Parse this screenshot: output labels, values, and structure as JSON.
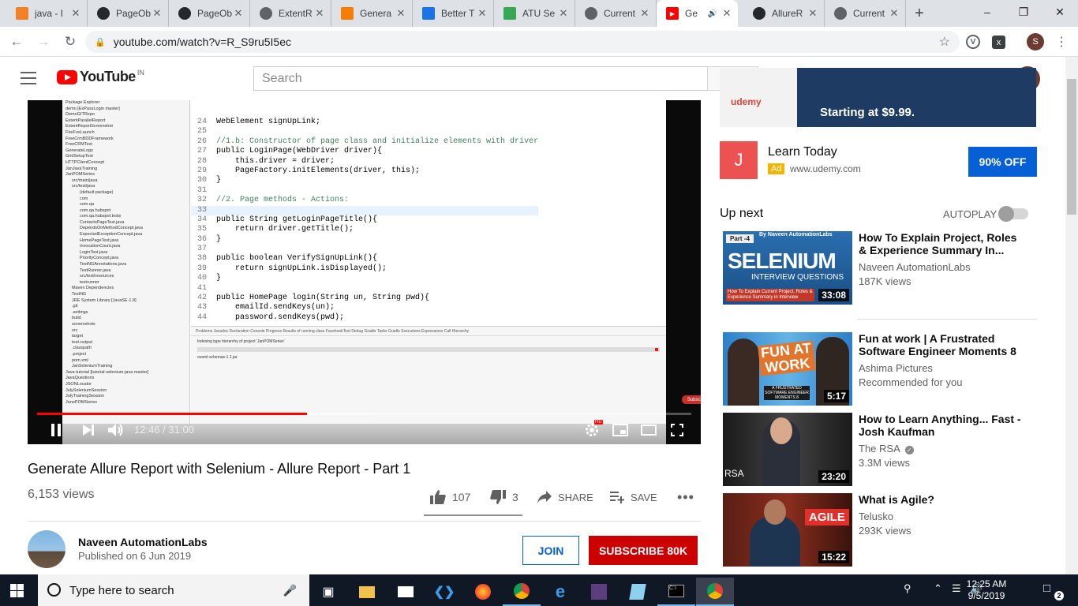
{
  "browser": {
    "tabs": [
      {
        "label": "java - I",
        "icon": "stackoverflow-icon",
        "color": "#f48024"
      },
      {
        "label": "PageOb",
        "icon": "github-icon",
        "color": "#24292e"
      },
      {
        "label": "PageOb",
        "icon": "github-icon",
        "color": "#24292e"
      },
      {
        "label": "ExtentR",
        "icon": "globe-icon",
        "color": "#5f6368"
      },
      {
        "label": "Genera",
        "icon": "blogger-icon",
        "color": "#f57d00"
      },
      {
        "label": "Better T",
        "icon": "doc-icon",
        "color": "#1a73e8"
      },
      {
        "label": "ATU Se",
        "icon": "drive-icon",
        "color": "#34a853"
      },
      {
        "label": "Current",
        "icon": "globe-icon",
        "color": "#5f6368"
      },
      {
        "label": "Ge",
        "icon": "youtube-icon",
        "color": "#ff0000",
        "active": true
      },
      {
        "label": "AllureR",
        "icon": "github-icon",
        "color": "#24292e"
      },
      {
        "label": "Current",
        "icon": "globe-icon",
        "color": "#5f6368"
      }
    ],
    "url": "youtube.com/watch?v=R_S9ru5I5ec"
  },
  "masthead": {
    "logo_text": "YouTube",
    "country": "IN",
    "search_placeholder": "Search",
    "avatar_letter": "S"
  },
  "player": {
    "current_time": "12:46",
    "duration": "31:00",
    "time_display": "12:46 / 31:00",
    "played_fraction": 0.412,
    "loaded_fraction": 0.515,
    "hd_badge": "HD",
    "subscribe_overlay": "Subscribe Now",
    "ide": {
      "explorer": [
        "Package Explorer",
        "demo [ExPassLogin master]",
        "DemoGITRepo",
        "ExtentParallelReport",
        "ExtentReportScreenshot",
        "FireFoxLaunch",
        "FreeCrmBDDFramework",
        "FreeCRMTest",
        "GenerateLogs",
        "GridSetupTest",
        "HTTPClientConcept",
        "JanJavaTraining",
        "JanPOMSeries",
        "src/main/java",
        "src/test/java",
        "(default package)",
        "com",
        "com.qa",
        "com.qa.hubspot",
        "com.qa.hubspot.tests",
        "ContactsPageTest.java",
        "DependsOnMethodConcept.java",
        "ExpectedExceptionConcept.java",
        "HomePageTest.java",
        "InvocationCount.java",
        "LoginTest.java",
        "PriorityConcept.java",
        "TestNGAnnotations.java",
        "TestRunner.java",
        "src/test/resources",
        "testrunner",
        "Maven Dependencies",
        "TestNG",
        "JRE System Library [JavaSE-1.8]",
        ".git",
        ".settings",
        "build",
        "screenshots",
        "src",
        "target",
        "test-output",
        ".classpath",
        ".project",
        "pom.xml",
        "JanSeleniumTraining",
        "Java-tutorial [tutorial-selenium-java master]",
        "JavaQuestions",
        "JSONLocator",
        "JulySeleniumSession",
        "JulyTrainingSession",
        "JunePOMSeries"
      ],
      "code": [
        {
          "n": "24",
          "t": "WebElement signUpLink;"
        },
        {
          "n": "25",
          "t": ""
        },
        {
          "n": "26",
          "t": "//1.b: Constructor of page class and initialize elements with driver",
          "cls": "cm"
        },
        {
          "n": "27",
          "t": "public LoginPage(WebDriver driver){"
        },
        {
          "n": "28",
          "t": "    this.driver = driver;"
        },
        {
          "n": "29",
          "t": "    PageFactory.initElements(driver, this);"
        },
        {
          "n": "30",
          "t": "}"
        },
        {
          "n": "31",
          "t": ""
        },
        {
          "n": "32",
          "t": "//2. Page methods - Actions:",
          "cls": "cm"
        },
        {
          "n": "33",
          "t": "",
          "cls": "hl"
        },
        {
          "n": "34",
          "t": "public String getLoginPageTitle(){"
        },
        {
          "n": "35",
          "t": "    return driver.getTitle();"
        },
        {
          "n": "36",
          "t": "}"
        },
        {
          "n": "37",
          "t": ""
        },
        {
          "n": "38",
          "t": "public boolean VerifySignUpLink(){"
        },
        {
          "n": "39",
          "t": "    return signUpLink.isDisplayed();"
        },
        {
          "n": "40",
          "t": "}"
        },
        {
          "n": "41",
          "t": ""
        },
        {
          "n": "42",
          "t": "public HomePage login(String un, String pwd){"
        },
        {
          "n": "43",
          "t": "    emailId.sendKeys(un);"
        },
        {
          "n": "44",
          "t": "    password.sendKeys(pwd);"
        }
      ],
      "console_tabs": "Problems   Javadoc   Declaration   Console   Progress   Results of running class FacebookTest   Debug   Gradle Tasks   Gradle Executions   Expressions   Call Hierarchy",
      "console_msg": "Indexing type hierarchy of project 'JanPOMSeries'",
      "console_msg2": "ooxml-schemas-1.1.jar"
    }
  },
  "video": {
    "title": "Generate Allure Report with Selenium - Allure Report - Part 1",
    "views": "6,153 views",
    "likes": "107",
    "dislikes": "3",
    "share_label": "SHARE",
    "save_label": "SAVE",
    "like_fraction": 0.973
  },
  "channel": {
    "name": "Naveen AutomationLabs",
    "published": "Published on 6 Jun 2019",
    "join_label": "JOIN",
    "subscribe_label": "SUBSCRIBE",
    "subscriber_count": "80K"
  },
  "ad": {
    "banner_brand": "udemy",
    "banner_text": "Starting at $9.99.",
    "icon_letter": "J",
    "title": "Learn Today",
    "badge": "Ad",
    "domain": "www.udemy.com",
    "cta": "90% OFF"
  },
  "sidebar": {
    "up_next": "Up next",
    "autoplay": "AUTOPLAY",
    "autoplay_on": false,
    "items": [
      {
        "title": "How To Explain Project, Roles & Experience Summary In...",
        "channel": "Naveen AutomationLabs",
        "meta": "187K views",
        "duration": "33:08",
        "thumb_label": "Part -4",
        "thumb_big": "SELENIUM",
        "thumb_sub": "INTERVIEW QUESTIONS",
        "thumb_top": "By Naveen AutomationLabs",
        "thumb_bottom": "How To Explain Current Project, Roles & Experience Summary in Interview"
      },
      {
        "title": "Fun at work | A Frustrated Software Engineer Moments 8",
        "channel": "Ashima Pictures",
        "meta": "Recommended for you",
        "duration": "5:17",
        "thumb_big": "FUN AT WORK",
        "thumb_bottom": "A FRUSTRATED SOFTWARE ENGINEER MOMENTS 8"
      },
      {
        "title": "How to Learn Anything... Fast - Josh Kaufman",
        "channel": "The RSA",
        "meta": "3.3M views",
        "duration": "23:20",
        "thumb_big": "RSA",
        "verified": true
      },
      {
        "title": "What is Agile?",
        "channel": "Telusko",
        "meta": "293K views",
        "duration": "15:22",
        "thumb_big": "AGILE"
      }
    ]
  },
  "taskbar": {
    "search_placeholder": "Type here to search",
    "time": "12:25 AM",
    "date": "9/5/2019",
    "notifications": "2"
  }
}
